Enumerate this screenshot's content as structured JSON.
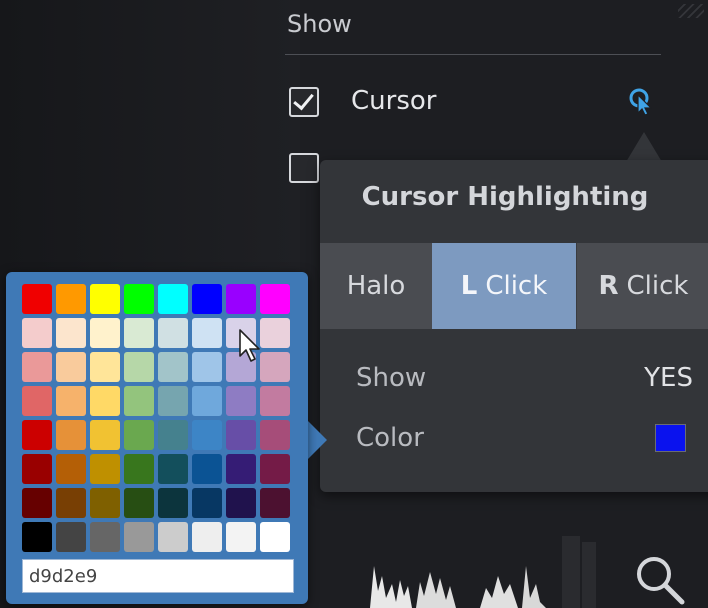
{
  "show_section": {
    "title": "Show",
    "items": [
      {
        "label": "Cursor",
        "checked": true,
        "icon": "cursor-click-icon",
        "icon_color": "#3fa3e6"
      },
      {
        "label": "",
        "checked": false
      }
    ]
  },
  "cursor_highlighting": {
    "title": "Cursor Highlighting",
    "tabs": [
      {
        "label": "Halo",
        "prefix": "",
        "active": false
      },
      {
        "label": "Click",
        "prefix": "L",
        "active": true
      },
      {
        "label": "Click",
        "prefix": "R",
        "active": false
      }
    ],
    "show": {
      "label": "Show",
      "value": "YES"
    },
    "color": {
      "label": "Color",
      "swatch": "#0a12ee"
    }
  },
  "color_picker": {
    "hex_value": "d9d2e9",
    "colors": [
      [
        "#f00000",
        "#ff9900",
        "#ffff00",
        "#00ff00",
        "#00ffff",
        "#0000ff",
        "#9900ff",
        "#ff00ff"
      ],
      [
        "#f4cccc",
        "#fce5cd",
        "#fff2cc",
        "#d9ead3",
        "#d0e0e3",
        "#cfe2f3",
        "#d9d2e9",
        "#ead1dc"
      ],
      [
        "#ea9999",
        "#f9cb9c",
        "#ffe599",
        "#b6d7a8",
        "#a2c4c9",
        "#9fc5e8",
        "#b4a7d6",
        "#d5a6bd"
      ],
      [
        "#e06666",
        "#f6b26b",
        "#ffd966",
        "#93c47d",
        "#76a5af",
        "#6fa8dc",
        "#8e7cc3",
        "#c27ba0"
      ],
      [
        "#cc0000",
        "#e69138",
        "#f1c232",
        "#6aa84f",
        "#45818e",
        "#3d85c6",
        "#674ea7",
        "#a64d79"
      ],
      [
        "#990000",
        "#b45f06",
        "#bf9000",
        "#38761d",
        "#134f5c",
        "#0b5394",
        "#351c75",
        "#741b47"
      ],
      [
        "#660000",
        "#783f04",
        "#7f6000",
        "#274e13",
        "#0c343d",
        "#073763",
        "#20124d",
        "#4c1130"
      ],
      [
        "#000000",
        "#444444",
        "#666666",
        "#999999",
        "#cccccc",
        "#eeeeee",
        "#f3f3f3",
        "#ffffff"
      ]
    ]
  },
  "theme": {
    "background": "#1d1e22",
    "popup_bg": "#333539",
    "tab_active_bg": "#7d9ac0",
    "picker_bg": "#3f79b6"
  },
  "icons": {
    "search": "magnifier-icon",
    "pointer": "mouse-pointer-icon"
  }
}
